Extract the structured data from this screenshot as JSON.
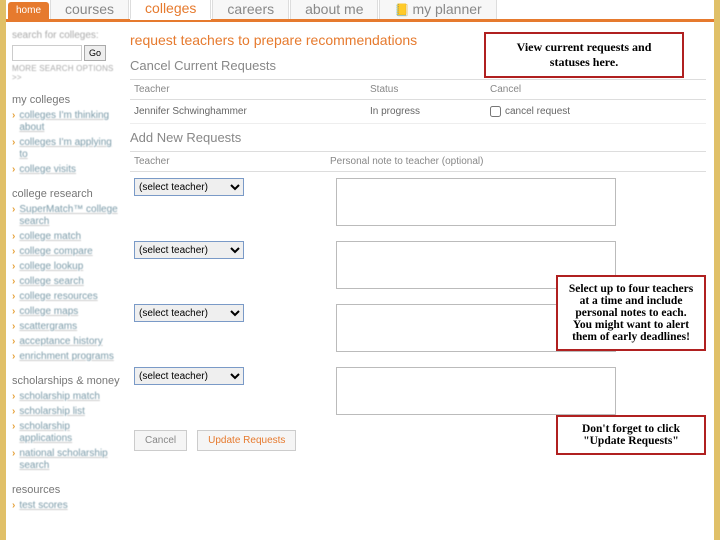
{
  "nav": {
    "home": "home",
    "items": [
      {
        "label": "courses"
      },
      {
        "label": "colleges"
      },
      {
        "label": "careers"
      },
      {
        "label": "about me"
      },
      {
        "label": "my planner"
      }
    ]
  },
  "sidebar": {
    "search_label": "search for colleges:",
    "go": "Go",
    "more": "MORE SEARCH OPTIONS >>",
    "groups": [
      {
        "heading": "my colleges",
        "links": [
          "colleges I'm thinking about",
          "colleges I'm applying to",
          "college visits"
        ]
      },
      {
        "heading": "college research",
        "links": [
          "SuperMatch™ college search",
          "college match",
          "college compare",
          "college lookup",
          "college search",
          "college resources",
          "college maps",
          "scattergrams",
          "acceptance history",
          "enrichment programs"
        ]
      },
      {
        "heading": "scholarships & money",
        "links": [
          "scholarship match",
          "scholarship list",
          "scholarship applications",
          "national scholarship search"
        ]
      },
      {
        "heading": "resources",
        "links": [
          "test scores"
        ]
      }
    ]
  },
  "main": {
    "page_title": "request teachers to prepare recommendations",
    "cancel_section": "Cancel Current Requests",
    "headers": {
      "teacher": "Teacher",
      "status": "Status",
      "cancel": "Cancel"
    },
    "current": [
      {
        "teacher": "Jennifer Schwinghammer",
        "status": "In progress",
        "cancel_label": "cancel request"
      }
    ],
    "add_section": "Add New Requests",
    "add_headers": {
      "teacher": "Teacher",
      "note": "Personal note to teacher (optional)"
    },
    "select_placeholder": "(select teacher)",
    "buttons": {
      "cancel": "Cancel",
      "update": "Update Requests"
    }
  },
  "callouts": {
    "c1": "View current requests and statuses here.",
    "c2": "Select up to four teachers at a time and include personal notes to each.  You might want to alert them of early deadlines!",
    "c3": "Don't forget to click \"Update Requests\""
  }
}
